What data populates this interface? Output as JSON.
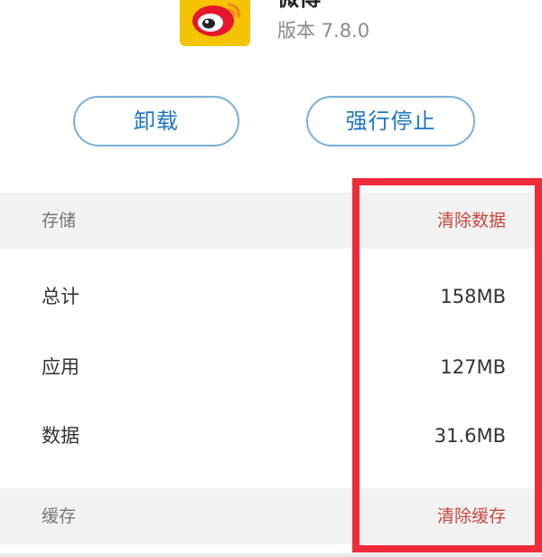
{
  "app": {
    "name": "微博",
    "version": "版本 7.8.0"
  },
  "buttons": {
    "uninstall": "卸载",
    "force_stop": "强行停止"
  },
  "storage": {
    "title": "存储",
    "action": "清除数据",
    "rows": [
      {
        "label": "总计",
        "value": "158MB"
      },
      {
        "label": "应用",
        "value": "127MB"
      },
      {
        "label": "数据",
        "value": "31.6MB"
      }
    ]
  },
  "cache": {
    "title": "缓存",
    "action": "清除缓存"
  },
  "colors": {
    "accent_blue": "#1e77c0",
    "action_red": "#c8463e",
    "highlight_red": "#ef2b3a",
    "icon_yellow": "#f6c300"
  }
}
